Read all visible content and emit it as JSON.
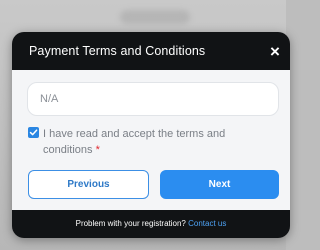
{
  "modal": {
    "title": "Payment Terms and Conditions",
    "close_symbol": "×",
    "field_value": "N/A",
    "terms_label": "I have read and accept the terms and conditions",
    "required_mark": "*",
    "checkbox_checked": true,
    "previous_label": "Previous",
    "next_label": "Next",
    "footer_text": "Problem with your registration?",
    "footer_link": "Contact us"
  },
  "colors": {
    "modal_background": "#111315",
    "accent_blue": "#2b8df0",
    "link_blue": "#4ea3f5",
    "required_red": "#e0282f"
  }
}
